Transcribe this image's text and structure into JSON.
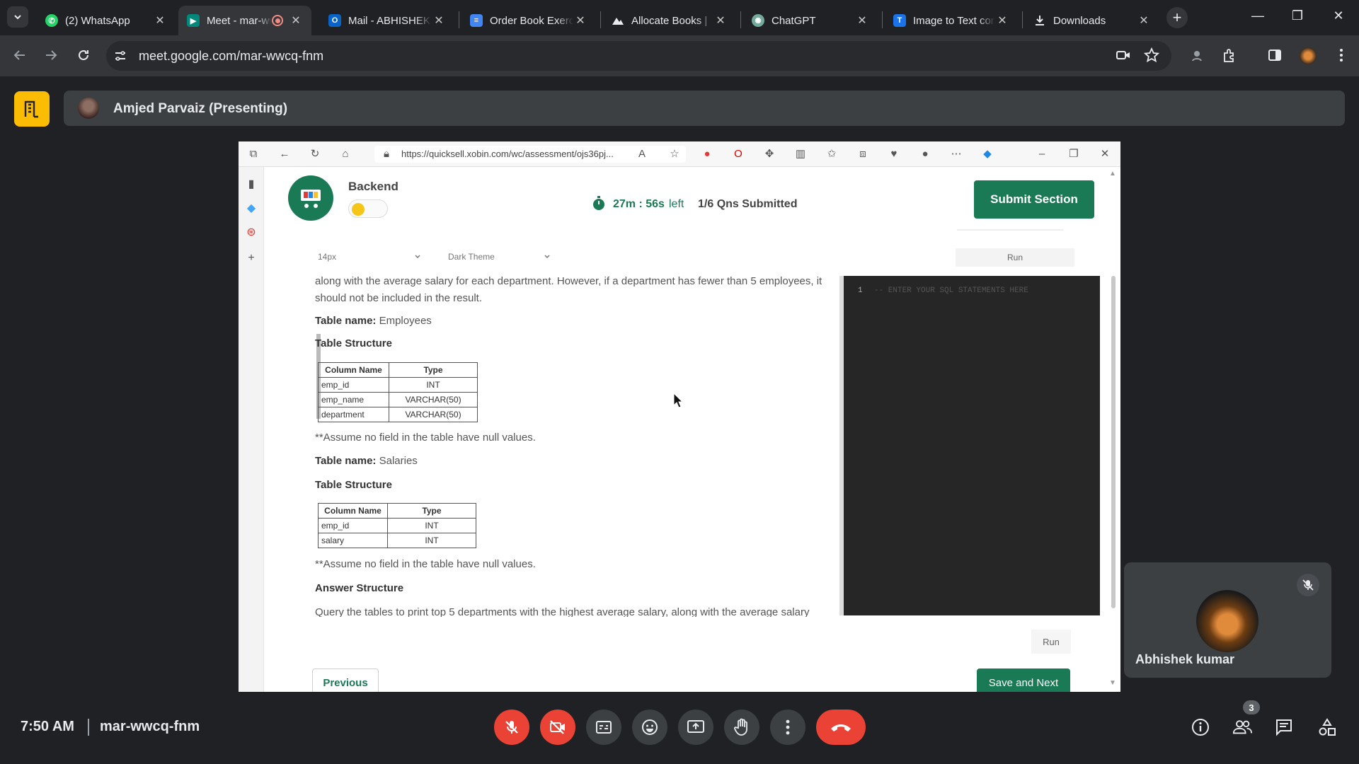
{
  "browser": {
    "tabs": [
      {
        "label": "(2) WhatsApp",
        "icon": "whatsapp-icon",
        "color": "#25d366"
      },
      {
        "label": "Meet - mar-wwcq-fnm",
        "icon": "google-meet-icon",
        "color": "#00897b",
        "active": true,
        "recording": true
      },
      {
        "label": "Mail - ABHISHEK KUMAR",
        "icon": "outlook-icon",
        "color": "#0a64c8"
      },
      {
        "label": "Order Book Exercise",
        "icon": "google-docs-icon",
        "color": "#4285f4"
      },
      {
        "label": "Allocate Books | ",
        "icon": "mountain-icon",
        "color": "#e8eaed"
      },
      {
        "label": "ChatGPT",
        "icon": "chatgpt-icon",
        "color": "#74aa9c"
      },
      {
        "label": "Image to Text converter",
        "icon": "text-icon",
        "color": "#1a73e8"
      },
      {
        "label": "Downloads",
        "icon": "download-icon",
        "color": "#e8eaed"
      }
    ],
    "url": "meet.google.com/mar-wwcq-fnm"
  },
  "meet": {
    "presenter": "Amjed Parvaiz (Presenting)",
    "self_name": "Abhishek kumar",
    "clock": "7:50 AM",
    "meeting_code": "mar-wwcq-fnm",
    "participant_count": "3",
    "accent_red": "#ea4335"
  },
  "shared": {
    "inner_url": "https://quicksell.xobin.com/wc/assessment/ojs36pj...",
    "section": "Backend",
    "timer": "27m : 56s",
    "timer_suffix": "left",
    "submitted": "1/6 Qns Submitted",
    "submit_button": "Submit Section",
    "font_size_select": "14px",
    "theme_select": "Dark Theme",
    "run_top": "Run",
    "run_bottom": "Run",
    "question_lead": "along with the average salary for each department. However, if a department has fewer than 5 employees, it should not be included in the result.",
    "table1_label": "Table name:",
    "table1_name": "Employees",
    "structure_label": "Table Structure",
    "schema_headers": [
      "Column Name",
      "Type"
    ],
    "table1_rows": [
      {
        "col": "emp_id",
        "type": "INT"
      },
      {
        "col": "emp_name",
        "type": "VARCHAR(50)"
      },
      {
        "col": "department",
        "type": "VARCHAR(50)"
      }
    ],
    "null_note": "**Assume no field in the table have null values.",
    "table2_label": "Table name:",
    "table2_name": "Salaries",
    "table2_rows": [
      {
        "col": "emp_id",
        "type": "INT"
      },
      {
        "col": "salary",
        "type": "INT"
      }
    ],
    "answer_structure": "Answer Structure",
    "answer_text": "Query the tables to print top 5 departments with the highest average salary, along with the average salary",
    "editor_line_number": "1",
    "editor_placeholder": "-- ENTER YOUR SQL STATEMENTS HERE",
    "previous_button": "Previous",
    "save_next_button": "Save and Next",
    "brand_green": "#1b7a56"
  }
}
